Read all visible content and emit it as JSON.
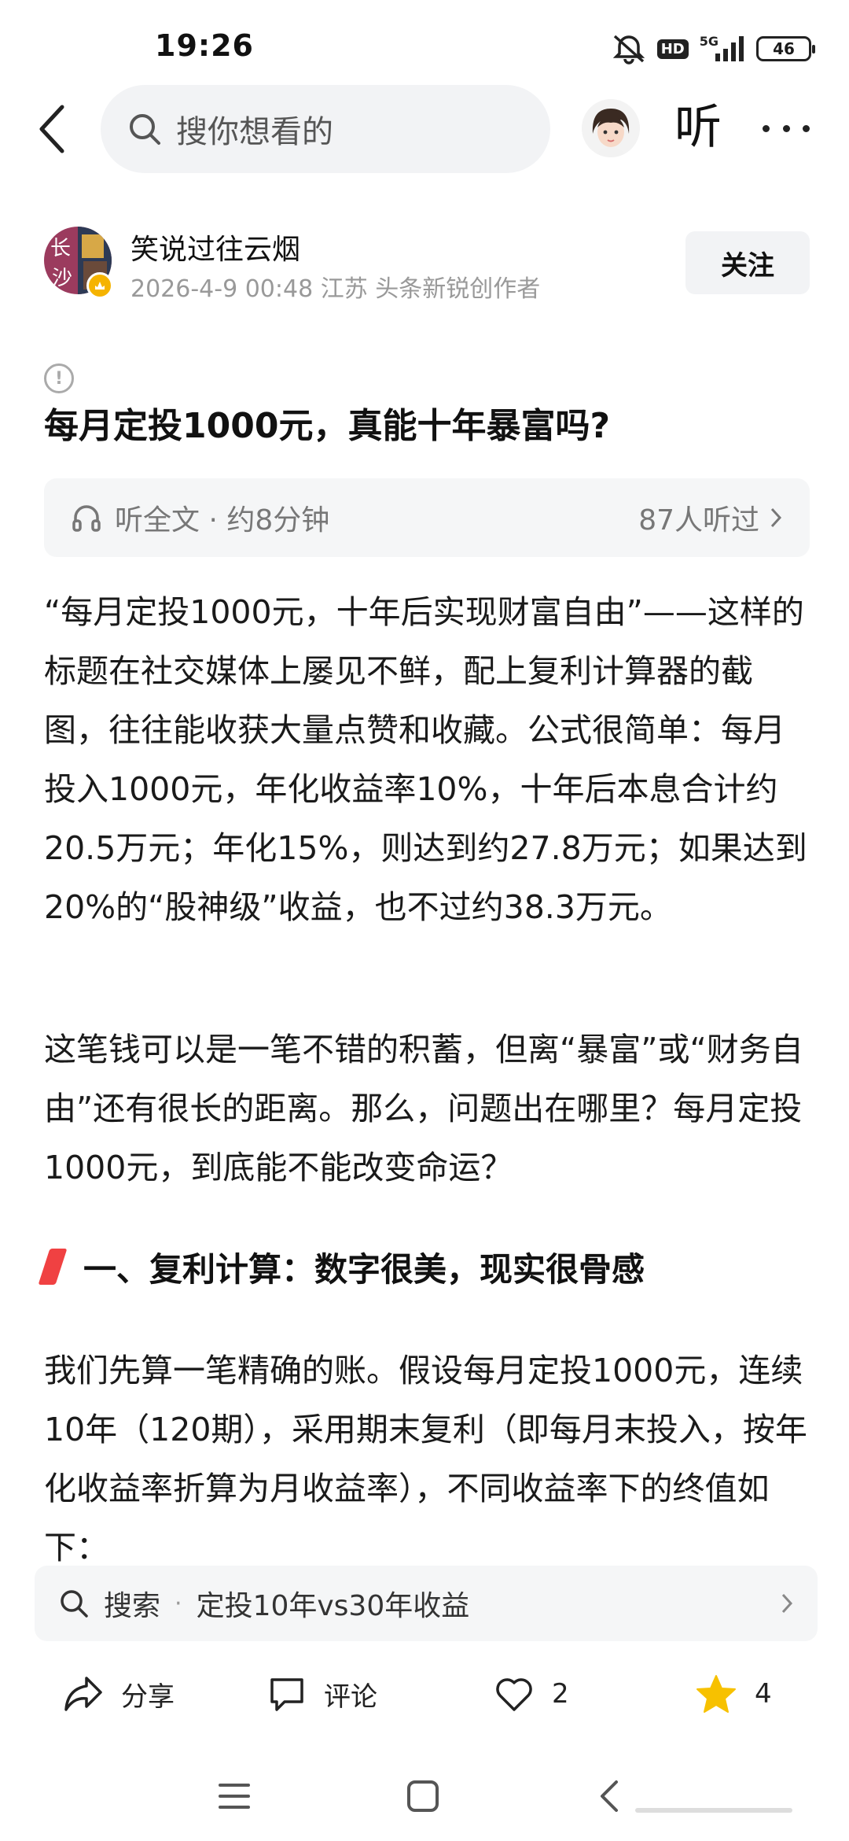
{
  "status_bar": {
    "time": "19:26",
    "hd": "HD",
    "network": "5G",
    "battery": "46"
  },
  "top_nav": {
    "search_placeholder": "搜你想看的",
    "listen_label": "听"
  },
  "author": {
    "name": "笑说过往云烟",
    "meta": "2026-4-9  00:48  江苏  头条新锐创作者",
    "follow_label": "关注"
  },
  "article": {
    "title": "每月定投1000元，真能十年暴富吗?",
    "listen_text": "听全文 · 约8分钟",
    "listeners": "87人听过",
    "paragraphs": [
      "“每月定投1000元，十年后实现财富自由”——这样的标题在社交媒体上屡见不鲜，配上复利计算器的截图，往往能收获大量点赞和收藏。公式很简单：每月投入1000元，年化收益率10%，十年后本息合计约20.5万元；年化15%，则达到约27.8万元；如果达到20%的“股神级”收益，也不过约38.3万元。",
      "这笔钱可以是一笔不错的积蓄，但离“暴富”或“财务自由”还有很长的距离。那么，问题出在哪里？每月定投1000元，到底能不能改变命运？",
      "我们先算一笔精确的账。假设每月定投1000元，连续10年（120期），采用期末复利（即每月末投入，按年化收益率折算为月收益率），不同收益率下的终值如下："
    ],
    "section_heading": "一、复利计算：数字很美，现实很骨感"
  },
  "suggestion": {
    "prefix": "搜索",
    "separator": "·",
    "query": "定投10年vs30年收益"
  },
  "actions": {
    "share_label": "分享",
    "comment_label": "评论",
    "like_count": "2",
    "favorite_count": "4"
  },
  "colors": {
    "accent_red": "#f04142",
    "star_yellow": "#f7c100",
    "muted_bg": "#f5f6f7"
  }
}
